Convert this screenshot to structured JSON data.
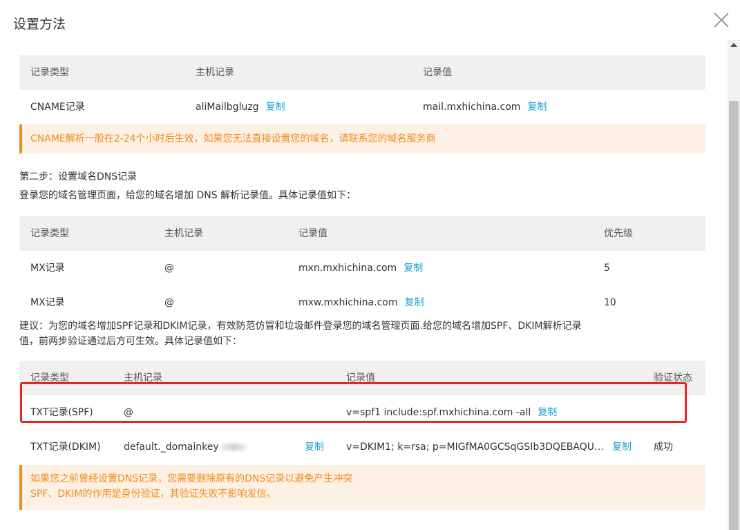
{
  "dialog": {
    "title": "设置方法"
  },
  "cname_table": {
    "headers": [
      "记录类型",
      "主机记录",
      "记录值"
    ],
    "row": {
      "type": "CNAME记录",
      "host": "aliMailbgluzg",
      "value": "mail.mxhichina.com"
    },
    "copy_label": "复制"
  },
  "cname_notice": "CNAME解析一般在2-24个小时后生效，如果您无法直接设置您的域名，请联系您的域名服务商",
  "step2": {
    "title": "第二步：设置域名DNS记录",
    "desc": "登录您的域名管理页面，给您的域名增加 DNS 解析记录值。具体记录值如下："
  },
  "mx_table": {
    "headers": [
      "记录类型",
      "主机记录",
      "记录值",
      "优先级"
    ],
    "rows": [
      {
        "type": "MX记录",
        "host": "@",
        "value": "mxn.mxhichina.com",
        "priority": "5"
      },
      {
        "type": "MX记录",
        "host": "@",
        "value": "mxw.mxhichina.com",
        "priority": "10"
      }
    ],
    "copy_label": "复制"
  },
  "advice": {
    "line1": "建议：为您的域名增加SPF记录和DKIM记录，有效防范仿冒和垃圾邮件登录您的域名管理页面.给您的域名增加SPF、DKIM解析记录",
    "line2": "值，前两步验证通过后方可生效。具体记录值如下："
  },
  "txt_table": {
    "headers": [
      "记录类型",
      "主机记录",
      "记录值",
      "验证状态"
    ],
    "rows": [
      {
        "type": "TXT记录(SPF)",
        "host": "@",
        "value": "v=spf1 include:spf.mxhichina.com -all",
        "status": ""
      },
      {
        "type": "TXT记录(DKIM)",
        "host": "default._domainkey",
        "value": "v=DKIM1; k=rsa; p=MIGfMA0GCSqGSIb3DQEBAQU…",
        "status": "成功"
      }
    ],
    "copy_label": "复制"
  },
  "bottom_notice": {
    "line1": "如果您之前曾经设置DNS记录，您需要删除原有的DNS记录以避免产生冲突",
    "line2": "SPF、DKIM的作用是身份验证，其验证失败不影响发信。"
  },
  "colors": {
    "link": "#1aa0d8",
    "warning": "#f28c1c",
    "warning_bg": "#fdf0e4",
    "success": "#3aa63a",
    "highlight": "#e5261f"
  }
}
